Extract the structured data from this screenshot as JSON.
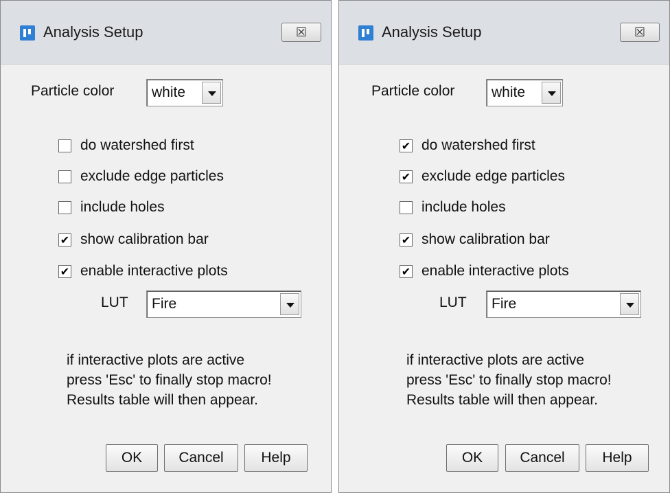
{
  "dialogs": [
    {
      "title": "Analysis Setup",
      "close_glyph": "☒",
      "particle_color_label": "Particle color",
      "particle_color_value": "white",
      "checkboxes": [
        {
          "label": "do watershed first",
          "checked": false
        },
        {
          "label": "exclude edge particles",
          "checked": false
        },
        {
          "label": "include holes",
          "checked": false
        },
        {
          "label": "show calibration bar",
          "checked": true
        },
        {
          "label": "enable interactive plots",
          "checked": true
        }
      ],
      "lut_label": "LUT",
      "lut_value": "Fire",
      "info_lines": [
        "if interactive plots are active",
        "press 'Esc' to finally stop macro!",
        "Results table will then appear."
      ],
      "buttons": {
        "ok": "OK",
        "cancel": "Cancel",
        "help": "Help"
      }
    },
    {
      "title": "Analysis Setup",
      "close_glyph": "☒",
      "particle_color_label": "Particle color",
      "particle_color_value": "white",
      "checkboxes": [
        {
          "label": "do watershed first",
          "checked": true
        },
        {
          "label": "exclude edge particles",
          "checked": true
        },
        {
          "label": "include holes",
          "checked": false
        },
        {
          "label": "show calibration bar",
          "checked": true
        },
        {
          "label": "enable interactive plots",
          "checked": true
        }
      ],
      "lut_label": "LUT",
      "lut_value": "Fire",
      "info_lines": [
        "if interactive plots are active",
        "press 'Esc' to finally stop macro!",
        "Results table will then appear."
      ],
      "buttons": {
        "ok": "OK",
        "cancel": "Cancel",
        "help": "Help"
      }
    }
  ],
  "icons": {
    "app": "imagej-icon",
    "close": "close-icon",
    "dropdown": "chevron-down-icon",
    "check": "✔"
  }
}
